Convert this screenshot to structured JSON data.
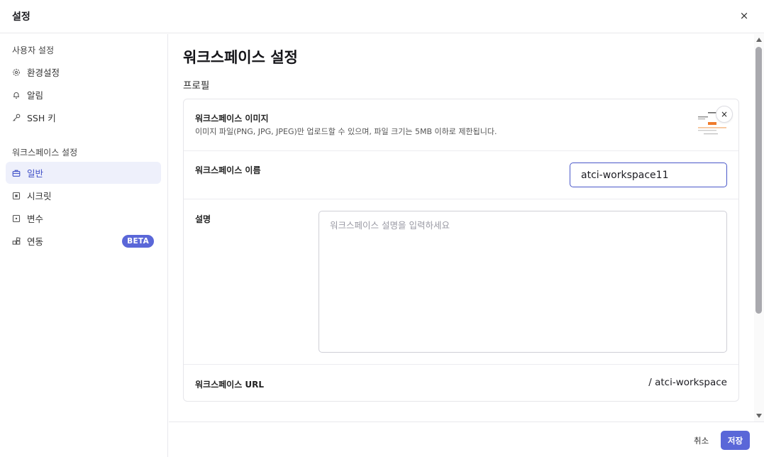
{
  "header": {
    "title": "설정",
    "close_label": "×"
  },
  "sidebar": {
    "user_section": "사용자 설정",
    "user_items": [
      {
        "label": "환경설정",
        "icon": "gear-icon"
      },
      {
        "label": "알림",
        "icon": "bell-icon"
      },
      {
        "label": "SSH 키",
        "icon": "key-icon"
      }
    ],
    "workspace_section": "워크스페이스 설정",
    "workspace_items": [
      {
        "label": "일반",
        "icon": "briefcase-icon",
        "active": true
      },
      {
        "label": "시크릿",
        "icon": "secret-icon"
      },
      {
        "label": "변수",
        "icon": "variable-icon"
      },
      {
        "label": "연동",
        "icon": "integration-icon",
        "badge": "BETA"
      }
    ]
  },
  "main": {
    "title": "워크스페이스 설정",
    "section": "프로필",
    "image": {
      "label": "워크스페이스 이미지",
      "desc": "이미지 파일(PNG, JPG, JPEG)만 업로드할 수 있으며, 파일 크기는 5MB 이하로 제한됩니다.",
      "remove_label": "×"
    },
    "name": {
      "label": "워크스페이스 이름",
      "value": "atci-workspace11"
    },
    "description": {
      "label": "설명",
      "placeholder": "워크스페이스 설명을 입력하세요"
    },
    "url": {
      "label": "워크스페이스 URL",
      "value": "/ atci-workspace"
    }
  },
  "footer": {
    "cancel": "취소",
    "save": "저장"
  },
  "colors": {
    "accent": "#5a67d8",
    "active_bg": "#eef0fb",
    "active_text": "#3f4fc7"
  }
}
